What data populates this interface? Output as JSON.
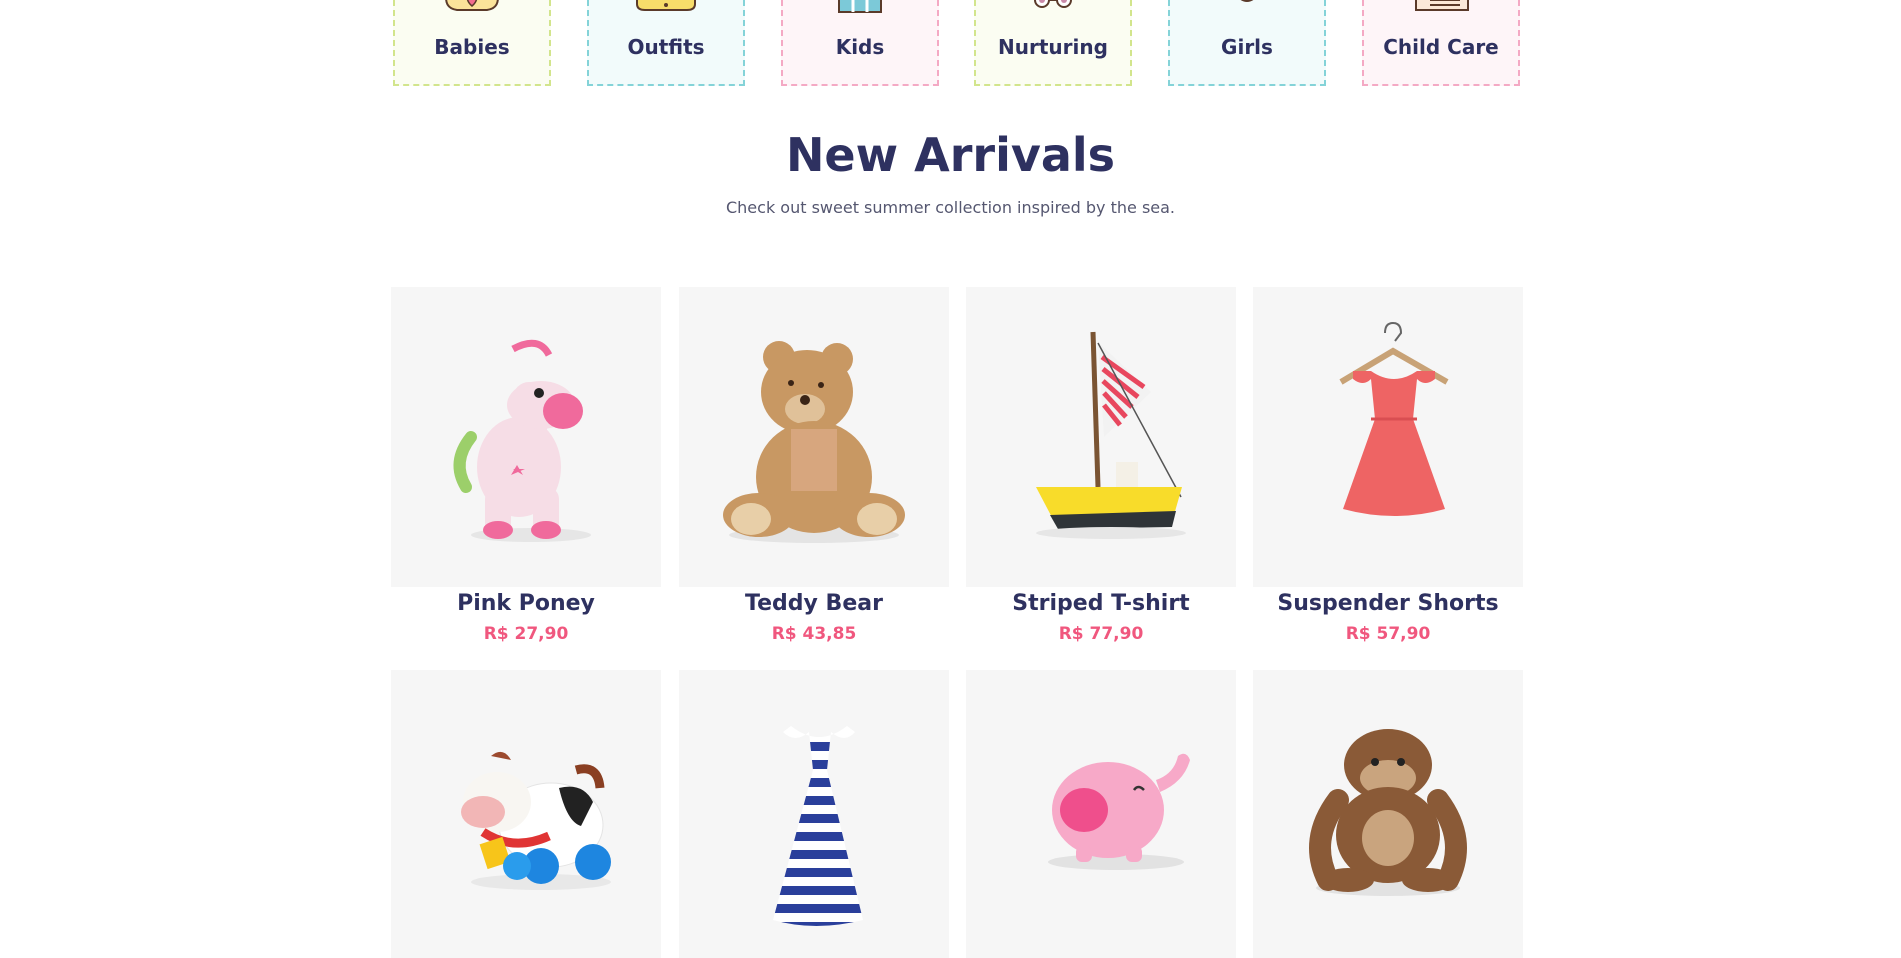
{
  "categories": [
    {
      "label": "Babies",
      "icon": "babies-icon"
    },
    {
      "label": "Outfits",
      "icon": "outfits-icon"
    },
    {
      "label": "Kids",
      "icon": "kids-icon"
    },
    {
      "label": "Nurturing",
      "icon": "nurturing-icon"
    },
    {
      "label": "Girls",
      "icon": "girls-icon"
    },
    {
      "label": "Child Care",
      "icon": "child-care-icon"
    }
  ],
  "section": {
    "title": "New Arrivals",
    "subtitle": "Check out sweet summer collection inspired by the sea."
  },
  "products": [
    {
      "name": "Pink Poney",
      "price": "R$ 27,90",
      "image": "pink-pony-toy"
    },
    {
      "name": "Teddy Bear",
      "price": "R$ 43,85",
      "image": "teddy-bear-toy"
    },
    {
      "name": "Striped T-shirt",
      "price": "R$ 77,90",
      "image": "toy-sailboat"
    },
    {
      "name": "Suspender Shorts",
      "price": "R$ 57,90",
      "image": "red-dress-on-hanger"
    },
    {
      "name": "",
      "price": "",
      "image": "toy-cow-on-wheels"
    },
    {
      "name": "",
      "price": "",
      "image": "blue-striped-dress"
    },
    {
      "name": "",
      "price": "",
      "image": "pink-elephant-piggy-bank"
    },
    {
      "name": "",
      "price": "",
      "image": "plush-monkey"
    }
  ],
  "colors": {
    "heading": "#2e3160",
    "price": "#f0577e",
    "border_green": "#d2e58c",
    "border_teal": "#84d3d8",
    "border_pink": "#f4a9c4"
  }
}
